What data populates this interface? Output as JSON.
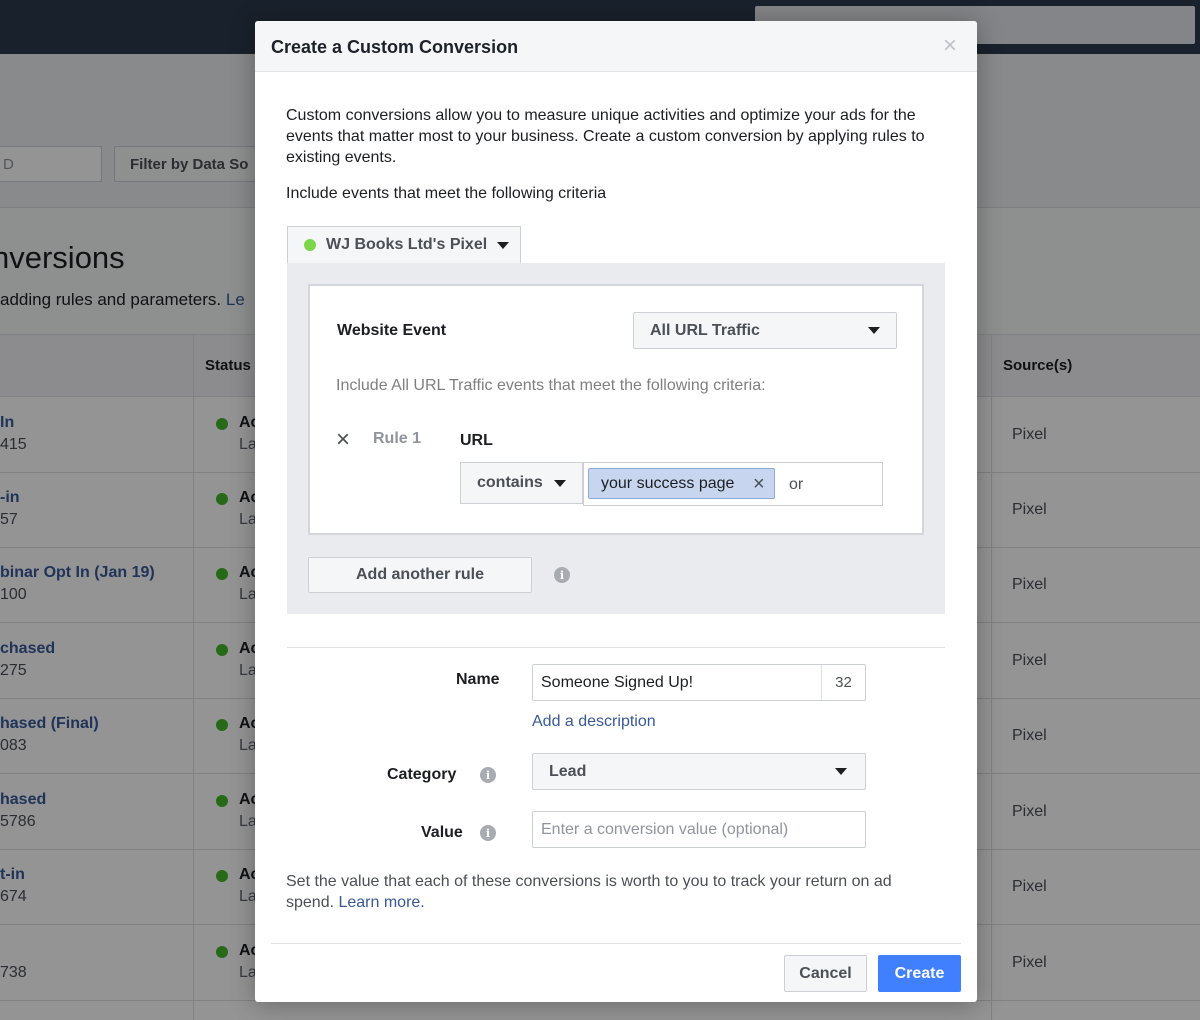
{
  "background": {
    "search_value": "D",
    "filter_label": "Filter by Data So",
    "heading": "nversions",
    "subheading": "adding rules and parameters. ",
    "subheading_link": "Le",
    "columns": {
      "status": "Status",
      "sources": "Source(s)"
    },
    "rows": [
      {
        "name": "In",
        "id": "415",
        "status": "Ac",
        "status_sub": "La",
        "source": "Pixel"
      },
      {
        "name": "-in",
        "id": "57",
        "status": "Ac",
        "status_sub": "La",
        "source": "Pixel"
      },
      {
        "name": "binar Opt In (Jan 19)",
        "id": "100",
        "status": "Ac",
        "status_sub": "La",
        "source": "Pixel"
      },
      {
        "name": "chased",
        "id": "275",
        "status": "Ac",
        "status_sub": "La",
        "source": "Pixel"
      },
      {
        "name": "hased (Final)",
        "id": "083",
        "status": "Ac",
        "status_sub": "La",
        "source": "Pixel"
      },
      {
        "name": "hased",
        "id": "5786",
        "status": "Ac",
        "status_sub": "La",
        "source": "Pixel"
      },
      {
        "name": "t-in",
        "id": "674",
        "status": "Ac",
        "status_sub": "La",
        "source": "Pixel"
      },
      {
        "name": "",
        "id": "738",
        "status": "Ac",
        "status_sub": "La",
        "source": "Pixel"
      }
    ]
  },
  "modal": {
    "title": "Create a Custom Conversion",
    "close_icon": "×",
    "intro": "Custom conversions allow you to measure unique activities and optimize your ads for the events that matter most to your business. Create a custom conversion by applying rules to existing events.",
    "criteria_text": "Include events that meet the following criteria",
    "pixel_label": "WJ Books Ltd's Pixel",
    "website_event_label": "Website Event",
    "website_event_value": "All URL Traffic",
    "include_text": "Include All URL Traffic events that meet the following criteria:",
    "rule_label": "Rule 1",
    "rule_remove_icon": "×",
    "url_label": "URL",
    "operator_value": "contains",
    "token_value": "your success page",
    "token_remove_icon": "×",
    "or_text": "or",
    "add_rule_label": "Add another rule",
    "info_glyph": "i",
    "name_label": "Name",
    "name_value": "Someone Signed Up!",
    "name_char_count": "32",
    "add_description": "Add a description",
    "category_label": "Category",
    "category_value": "Lead",
    "value_label": "Value",
    "value_placeholder": "Enter a conversion value (optional)",
    "value_note": "Set the value that each of these conversions is worth to you to track your return on ad spend. ",
    "value_note_link": "Learn more.",
    "cancel_label": "Cancel",
    "create_label": "Create"
  },
  "colors": {
    "primary_button": "#4080ff",
    "link": "#385898",
    "pixel_status": "#7cd64a",
    "row_status": "#42b72a",
    "topbar": "#2b3a4d"
  },
  "icons": {
    "close": "close-icon",
    "caret": "caret-down-icon",
    "info": "info-icon",
    "status_dot": "status-dot-icon"
  }
}
